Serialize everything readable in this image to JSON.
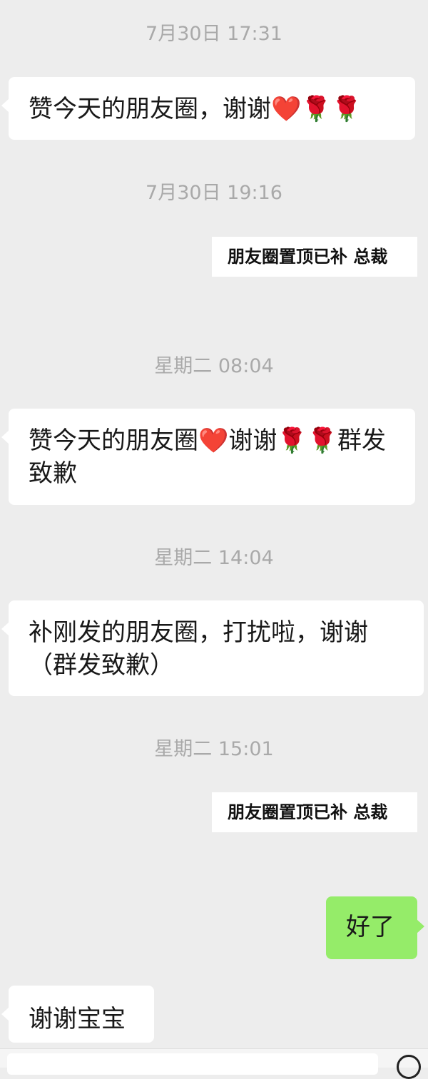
{
  "messages": [
    {
      "timestamp": "7月30日 17:31"
    },
    {
      "in_text": "赞今天的朋友圈，谢谢❤️🌹🌹"
    },
    {
      "timestamp": "7月30日 19:16"
    },
    {
      "sticker_text": "朋友圈置顶已补 总裁"
    },
    {
      "timestamp": "星期二 08:04"
    },
    {
      "in_text": "赞今天的朋友圈❤️谢谢🌹🌹群发致歉"
    },
    {
      "timestamp": "星期二 14:04"
    },
    {
      "in_text": "补刚发的朋友圈，打扰啦，谢谢（群发致歉）"
    },
    {
      "timestamp": "星期二 15:01"
    },
    {
      "sticker_text": "朋友圈置顶已补 总裁"
    },
    {
      "out_text": "好了"
    },
    {
      "in_text": "谢谢宝宝"
    }
  ],
  "colors": {
    "background": "#ededed",
    "incoming_bubble": "#ffffff",
    "outgoing_bubble": "#95ec69",
    "timestamp": "#a9a9a9"
  }
}
